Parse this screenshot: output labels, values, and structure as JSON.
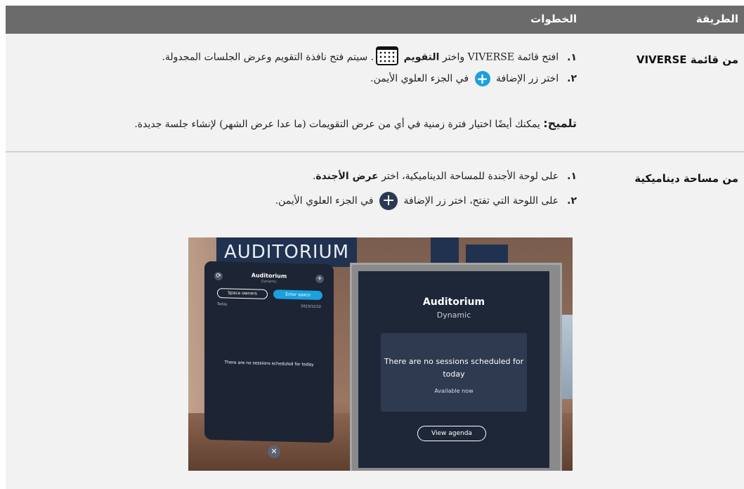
{
  "header": {
    "method": "الطريقة",
    "steps": "الخطوات"
  },
  "rows": [
    {
      "method": "من قائمة VIVERSE",
      "step1_num": "١.",
      "step1_a": "افتح قائمة VIVERSE واختر",
      "step1_kw": "التقويم",
      "step1_b": ". سيتم فتح نافذة التقويم وعرض الجلسات المجدولة.",
      "step2_num": "٢.",
      "step2_a": "اختر زر الإضافة",
      "step2_b": "في الجزء العلوي الأيمن.",
      "tip_label": "تلميح:",
      "tip_text": "يمكنك أيضًا اختيار فترة زمنية في أي من عرض التقويمات (ما عدا عرض الشهر) لإنشاء جلسة جديدة."
    },
    {
      "method": "من مساحة ديناميكية",
      "step1_num": "١.",
      "step1_a": "على لوحة الأجندة للمساحة الديناميكية، اختر",
      "step1_kw": "عرض الأجندة",
      "step1_b": ".",
      "step2_num": "٢.",
      "step2_a": "على اللوحة التي تفتح، اختر زر الإضافة",
      "step2_b": "في الجزء العلوي الأيمن."
    }
  ],
  "screenshot": {
    "banner": "AUDITORIUM",
    "left_panel": {
      "title": "Auditorium",
      "subtitle": "Dynamic",
      "btn_space_owners": "Space owners",
      "btn_enter_space": "Enter space",
      "today": "Today",
      "date": "2023/12/12",
      "empty": "There are no sessions scheduled for today"
    },
    "right_panel": {
      "title": "Auditorium",
      "subtitle": "Dynamic",
      "message": "There are no sessions scheduled for today",
      "available": "Available now",
      "view_agenda": "View agenda"
    }
  },
  "colors": {
    "header_bg": "#6b6b6b",
    "row_bg": "#f2f2f2",
    "accent_blue": "#1aa0de",
    "panel_dark": "#1e2738"
  }
}
